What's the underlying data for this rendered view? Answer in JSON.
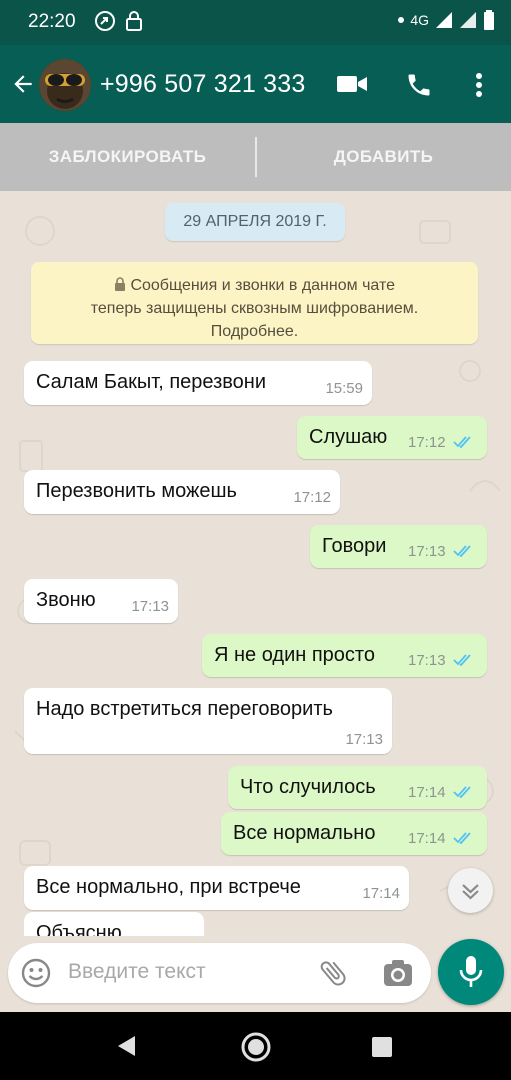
{
  "status_bar": {
    "time": "22:20",
    "network": "4G"
  },
  "header": {
    "title": "+996 507 321 333"
  },
  "actions": {
    "block_label": "ЗАБЛОКИРОВАТЬ",
    "add_label": "ДОБАВИТЬ"
  },
  "chat": {
    "date": "29 АПРЕЛЯ 2019 Г.",
    "system_lines": [
      "Сообщения и звонки в данном чате",
      "теперь защищены сквозным шифрованием.",
      "Подробнее."
    ],
    "messages": [
      {
        "dir": "in",
        "text": "Салам Бакыт, перезвони",
        "time": "15:59"
      },
      {
        "dir": "out",
        "text": "Слушаю",
        "time": "17:12"
      },
      {
        "dir": "in",
        "text": "Перезвонить можешь",
        "time": "17:12"
      },
      {
        "dir": "out",
        "text": "Говори",
        "time": "17:13"
      },
      {
        "dir": "in",
        "text": "Звоню",
        "time": "17:13"
      },
      {
        "dir": "out",
        "text": "Я не один просто",
        "time": "17:13"
      },
      {
        "dir": "in",
        "text": "Надо встретиться переговорить",
        "time": "17:13"
      },
      {
        "dir": "out",
        "text": "Что случилось",
        "time": "17:14"
      },
      {
        "dir": "out",
        "text": "Все нормально",
        "time": "17:14"
      },
      {
        "dir": "in",
        "text": "Все нормально, при встрече",
        "time": "17:14"
      },
      {
        "dir": "in",
        "text": "Объясню",
        "time": ""
      }
    ]
  },
  "input": {
    "placeholder": "Введите текст"
  },
  "colors": {
    "header": "#075e54",
    "status": "#0b544a",
    "accent": "#00897b",
    "outgoing": "#dcf8c6",
    "read_ticks": "#4fc3f7"
  },
  "icons": [
    "back-arrow-icon",
    "video-call-icon",
    "phone-icon",
    "more-vert-icon",
    "emoji-icon",
    "attach-icon",
    "camera-icon",
    "mic-icon",
    "scroll-down-icon",
    "lock-icon"
  ]
}
